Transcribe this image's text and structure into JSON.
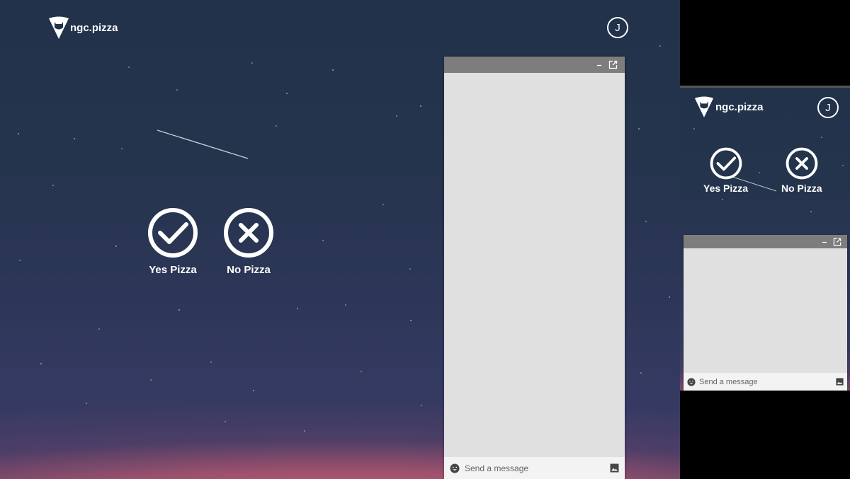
{
  "app": {
    "brand_name": "ngc.pizza",
    "avatar_initial": "J"
  },
  "choices": {
    "yes_label": "Yes Pizza",
    "no_label": "No Pizza"
  },
  "chat": {
    "placeholder": "Send a message",
    "icons": {
      "minimize": "minimize-icon",
      "popout": "popout-icon",
      "emoji": "emoji-icon",
      "image": "image-icon"
    }
  },
  "colors": {
    "sky_top": "#22324a",
    "sky_bottom": "#3d3b64",
    "horizon_glow": "#d65c6c",
    "chat_header": "#7d7d7d",
    "chat_body": "#e0e0e0",
    "chat_input": "#f3f3f3"
  }
}
